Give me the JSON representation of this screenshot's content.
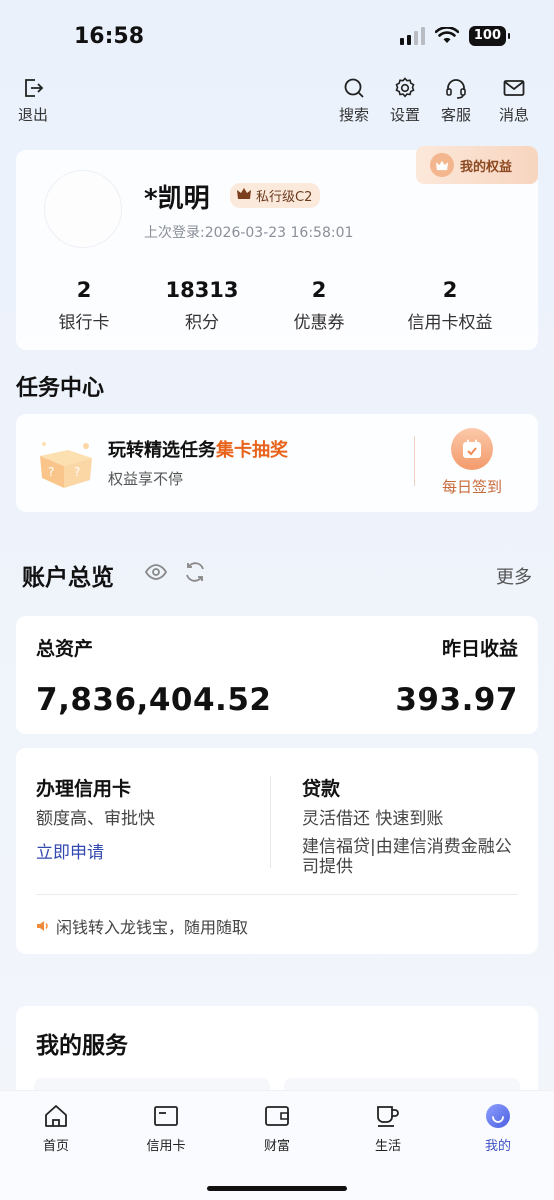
{
  "status": {
    "time": "16:58",
    "battery": "100"
  },
  "topnav": {
    "exit_label": "退出",
    "search_label": "搜索",
    "settings_label": "设置",
    "service_label": "客服",
    "message_label": "消息"
  },
  "profile": {
    "name": "*凯明",
    "level": "私行级C2",
    "last_login": "上次登录:2026-03-23 16:58:01",
    "rights_label": "我的权益",
    "stats": [
      {
        "value": "2",
        "label": "银行卡"
      },
      {
        "value": "18313",
        "label": "积分"
      },
      {
        "value": "2",
        "label": "优惠券"
      },
      {
        "value": "2",
        "label": "信用卡权益"
      }
    ]
  },
  "task_center": {
    "title": "任务中心",
    "headline_prefix": "玩转精选任务",
    "headline_highlight": "集卡抽奖",
    "subtitle": "权益享不停",
    "checkin_label": "每日签到"
  },
  "overview": {
    "title": "账户总览",
    "more_label": "更多",
    "total_assets_label": "总资产",
    "total_assets_value": "7,836,404.52",
    "yesterday_income_label": "昨日收益",
    "yesterday_income_value": "393.97"
  },
  "credit": {
    "card_title": "办理信用卡",
    "card_desc": "额度高、审批快",
    "card_link": "立即申请",
    "loan_title": "贷款",
    "loan_desc": "灵活借还 快速到账",
    "loan_provider_line1": "建信福贷|由建信消费金融公",
    "loan_provider_line2": "司提供",
    "notice": "闲钱转入龙钱宝，随用随取"
  },
  "services": {
    "title": "我的服务"
  },
  "tabbar": {
    "tabs": [
      {
        "label": "首页"
      },
      {
        "label": "信用卡"
      },
      {
        "label": "财富"
      },
      {
        "label": "生活"
      },
      {
        "label": "我的"
      }
    ]
  },
  "colors": {
    "accent": "#3f52c4",
    "highlight": "#e8641c",
    "link": "#3349b0"
  }
}
